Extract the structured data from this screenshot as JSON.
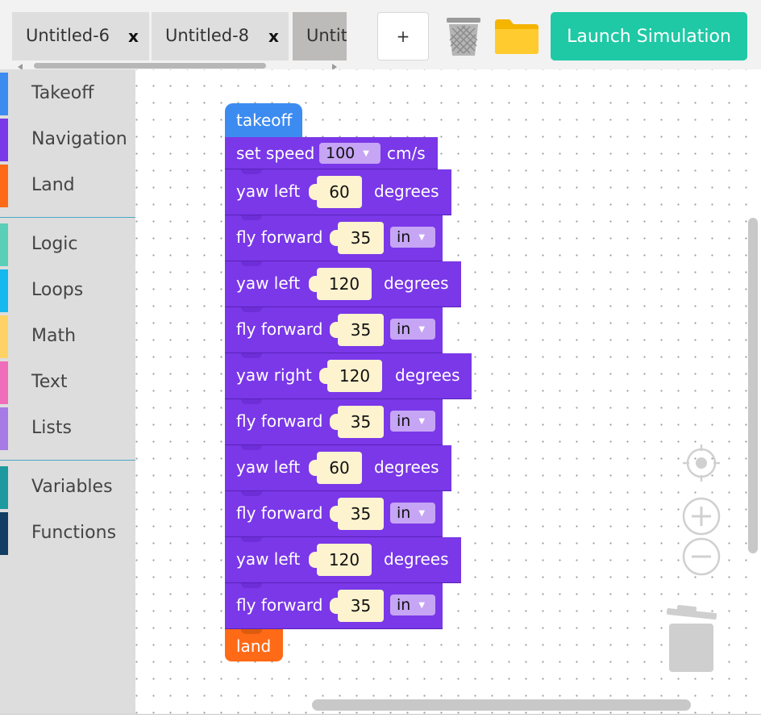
{
  "tabs": [
    {
      "title": "Untitled-6",
      "close": "x"
    },
    {
      "title": "Untitled-8",
      "close": "x"
    },
    {
      "title": "Untit"
    }
  ],
  "header": {
    "new_tab": "+",
    "launch_label": "Launch Simulation"
  },
  "toolbox": {
    "categories": [
      {
        "label": "Takeoff",
        "color": "#3c8bf1"
      },
      {
        "label": "Navigation",
        "color": "#7a38e8"
      },
      {
        "label": "Land",
        "color": "#ff6a17"
      },
      {
        "label": "Logic",
        "color": "#5acfb8"
      },
      {
        "label": "Loops",
        "color": "#15b9f0"
      },
      {
        "label": "Math",
        "color": "#ffd266"
      },
      {
        "label": "Text",
        "color": "#f06dbb"
      },
      {
        "label": "Lists",
        "color": "#a77ae6"
      },
      {
        "label": "Variables",
        "color": "#1d9aa0"
      },
      {
        "label": "Functions",
        "color": "#123e63"
      }
    ]
  },
  "program": {
    "takeoff": "takeoff",
    "speed": {
      "label": "set speed",
      "value": "100",
      "unit": "cm/s"
    },
    "steps": [
      {
        "label": "yaw left",
        "value": "60",
        "unit": "degrees"
      },
      {
        "label": "fly forward",
        "value": "35",
        "unit": "in"
      },
      {
        "label": "yaw left",
        "value": "120",
        "unit": "degrees"
      },
      {
        "label": "fly forward",
        "value": "35",
        "unit": "in"
      },
      {
        "label": "yaw right",
        "value": "120",
        "unit": "degrees"
      },
      {
        "label": "fly forward",
        "value": "35",
        "unit": "in"
      },
      {
        "label": "yaw left",
        "value": "60",
        "unit": "degrees"
      },
      {
        "label": "fly forward",
        "value": "35",
        "unit": "in"
      },
      {
        "label": "yaw left",
        "value": "120",
        "unit": "degrees"
      },
      {
        "label": "fly forward",
        "value": "35",
        "unit": "in"
      }
    ],
    "land": "land"
  },
  "colors": {
    "accent": "#1fc9a5",
    "navigation_block": "#7a38e8",
    "takeoff_block": "#3c8bf1",
    "land_block": "#ff6a17"
  }
}
